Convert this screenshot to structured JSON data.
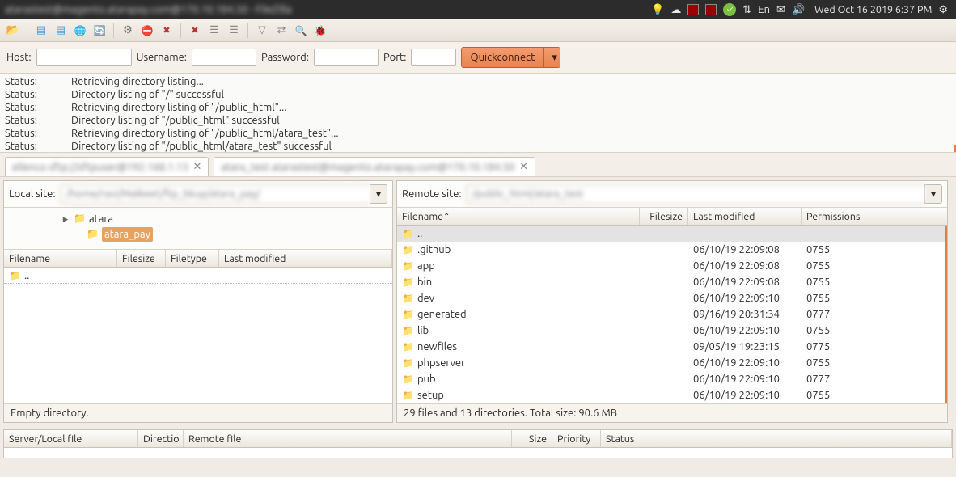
{
  "sysbar": {
    "title_blur": "atarastest@magento.atarapay.com@170.10.184.50 - FileZilla",
    "datetime": "Wed Oct 16 2019  6:37 PM",
    "lang": "En"
  },
  "quickconnect": {
    "host_label": "Host:",
    "user_label": "Username:",
    "pass_label": "Password:",
    "port_label": "Port:",
    "button": "Quickconnect",
    "host": "",
    "user": "",
    "pass": "",
    "port": ""
  },
  "log": [
    {
      "lbl": "Status:",
      "msg": "Retrieving directory listing..."
    },
    {
      "lbl": "Status:",
      "msg": "Directory listing of \"/\" successful"
    },
    {
      "lbl": "Status:",
      "msg": "Retrieving directory listing of \"/public_html\"..."
    },
    {
      "lbl": "Status:",
      "msg": "Directory listing of \"/public_html\" successful"
    },
    {
      "lbl": "Status:",
      "msg": "Retrieving directory listing of \"/public_html/atara_test\"..."
    },
    {
      "lbl": "Status:",
      "msg": "Directory listing of \"/public_html/atara_test\" successful"
    }
  ],
  "tabs": {
    "tab1_blur": "ellenco  sftp://sftpuser@192.168.1.13",
    "tab2_blur": "atara_test   atarastest@magento.atarapay.com@170.10.184.50"
  },
  "local": {
    "label": "Local site:",
    "path_blur": "/home/ravi/Malkeet/ftp_bkup/atara_pay/",
    "tree": {
      "parent": "atara",
      "sel": "atara_pay"
    },
    "cols": {
      "name": "Filename",
      "size": "Filesize",
      "type": "Filetype",
      "mod": "Last modified"
    },
    "rows": [
      {
        "name": ".."
      }
    ],
    "status": "Empty directory."
  },
  "remote": {
    "label": "Remote site:",
    "path_blur": "/public_html/atara_test",
    "cols": {
      "name": "Filename",
      "size": "Filesize",
      "mod": "Last modified",
      "perm": "Permissions"
    },
    "rows": [
      {
        "name": "..",
        "size": "",
        "mod": "",
        "perm": ""
      },
      {
        "name": ".github",
        "size": "",
        "mod": "06/10/19 22:09:08",
        "perm": "0755"
      },
      {
        "name": "app",
        "size": "",
        "mod": "06/10/19 22:09:08",
        "perm": "0755"
      },
      {
        "name": "bin",
        "size": "",
        "mod": "06/10/19 22:09:08",
        "perm": "0755"
      },
      {
        "name": "dev",
        "size": "",
        "mod": "06/10/19 22:09:10",
        "perm": "0755"
      },
      {
        "name": "generated",
        "size": "",
        "mod": "09/16/19 20:31:34",
        "perm": "0777"
      },
      {
        "name": "lib",
        "size": "",
        "mod": "06/10/19 22:09:10",
        "perm": "0755"
      },
      {
        "name": "newfiles",
        "size": "",
        "mod": "09/05/19 19:23:15",
        "perm": "0775"
      },
      {
        "name": "phpserver",
        "size": "",
        "mod": "06/10/19 22:09:10",
        "perm": "0755"
      },
      {
        "name": "pub",
        "size": "",
        "mod": "06/10/19 22:09:10",
        "perm": "0777"
      },
      {
        "name": "setup",
        "size": "",
        "mod": "06/10/19 22:09:10",
        "perm": "0755"
      }
    ],
    "status": "29 files and 13 directories. Total size: 90.6 MB"
  },
  "queue": {
    "cols": {
      "server": "Server/Local file",
      "dir": "Directio",
      "remote": "Remote file",
      "size": "Size",
      "prio": "Priority",
      "status": "Status"
    }
  }
}
